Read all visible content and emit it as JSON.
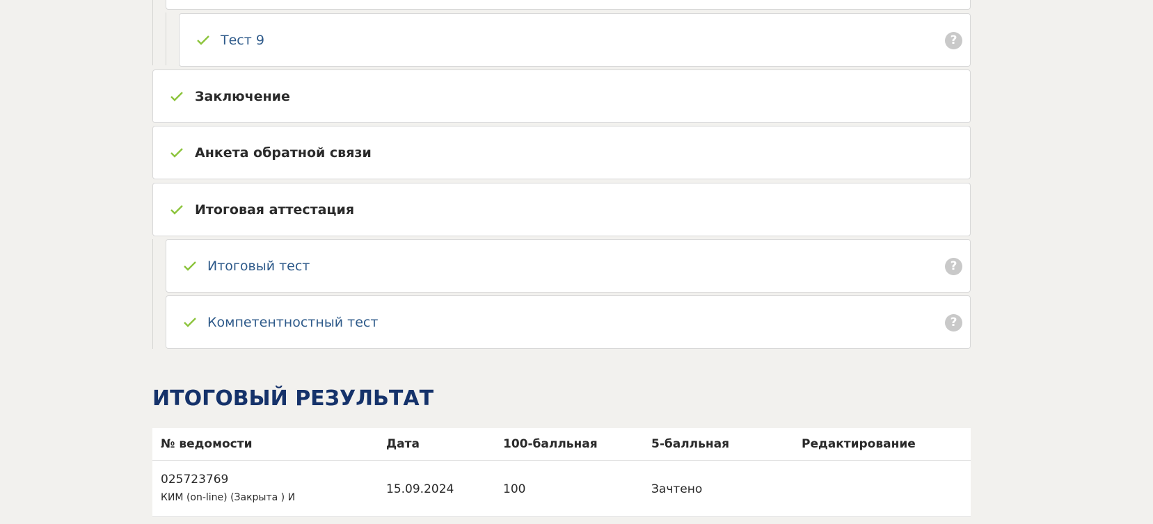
{
  "modules": {
    "test9": {
      "label": "Тест 9"
    },
    "conclusion": {
      "label": "Заключение"
    },
    "feedback": {
      "label": "Анкета обратной связи"
    },
    "final_attestation": {
      "label": "Итоговая аттестация"
    },
    "final_test": {
      "label": "Итоговый тест"
    },
    "competency_test": {
      "label": "Компетентностный тест"
    },
    "help_glyph": "?"
  },
  "result": {
    "title": "ИТОГОВЫЙ РЕЗУЛЬТАТ",
    "columns": [
      "№ ведомости",
      "Дата",
      "100-балльная",
      "5-балльная",
      "Редактирование"
    ],
    "rows": [
      {
        "number": "025723769",
        "kim": "КИМ (on-line) (Закрыта ) И",
        "date": "15.09.2024",
        "score100": "100",
        "score5": "Зачтено",
        "edit": ""
      }
    ]
  },
  "colors": {
    "check": "#8cc43c",
    "link": "#2e5a8a",
    "heading": "#15326a",
    "background": "#f2f1ee"
  },
  "icons": {
    "check": "check-icon",
    "help": "question-circle-icon"
  }
}
